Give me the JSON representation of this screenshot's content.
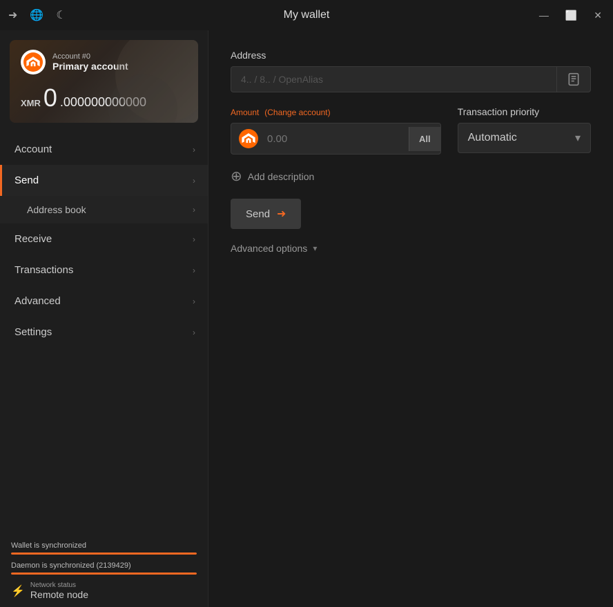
{
  "titlebar": {
    "title": "My wallet",
    "icons": {
      "arrow": "➜",
      "globe": "🌐",
      "moon": "☾"
    },
    "buttons": {
      "minimize": "—",
      "maximize": "⬜",
      "close": "✕"
    }
  },
  "sidebar": {
    "account_card": {
      "account_number": "Account #0",
      "account_name": "Primary account",
      "currency": "XMR",
      "balance_integer": "0",
      "balance_decimal": ".000000000000"
    },
    "nav_items": [
      {
        "label": "Account",
        "active": false,
        "id": "account"
      },
      {
        "label": "Send",
        "active": true,
        "id": "send"
      },
      {
        "label": "Address book",
        "active": false,
        "id": "address-book",
        "sub": true
      },
      {
        "label": "Receive",
        "active": false,
        "id": "receive"
      },
      {
        "label": "Transactions",
        "active": false,
        "id": "transactions"
      },
      {
        "label": "Advanced",
        "active": false,
        "id": "advanced"
      },
      {
        "label": "Settings",
        "active": false,
        "id": "settings"
      }
    ],
    "sync": {
      "wallet_label": "Wallet is synchronized",
      "daemon_label": "Daemon is synchronized (2139429)",
      "wallet_fill": "100%",
      "daemon_fill": "100%"
    },
    "network": {
      "status_label": "Network status",
      "status_value": "Remote node"
    }
  },
  "content": {
    "address_label": "Address",
    "address_placeholder": "4.. / 8.. / OpenAlias",
    "amount_label": "Amount",
    "change_account_label": "(Change account)",
    "amount_placeholder": "0.00",
    "all_button": "All",
    "priority_label": "Transaction priority",
    "priority_value": "Automatic",
    "add_description_label": "Add description",
    "send_button_label": "Send",
    "advanced_options_label": "Advanced options"
  }
}
